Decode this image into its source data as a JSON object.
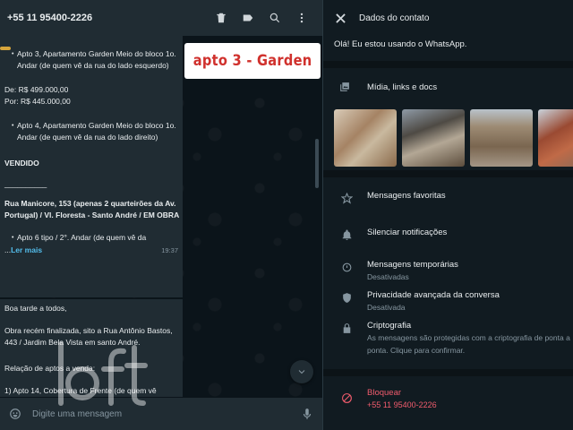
{
  "chat": {
    "header": {
      "phone": "+55 11 95400-2226"
    },
    "bubble1": {
      "apto3": "Apto 3, Apartamento Garden Meio do bloco 1o. Andar (de quem vê da rua do lado esquerdo)",
      "price_de": "De: R$ 499.000,00",
      "price_por": "Por: R$ 445.000,00",
      "apto4": "Apto 4, Apartamento Garden Meio do bloco 1o. Andar (de quem vê da rua do lado direito)",
      "sold": "VENDIDO",
      "divider": "__________",
      "address": "Rua Manicore, 153 (apenas 2 quarteirões da Av. Portugal) / Vl. Floresta - Santo André / EM OBRA",
      "apto6": "Apto 6 tipo / 2°. Andar (de quem vê da",
      "read_more_dots": "...",
      "read_more_link": "Ler mais",
      "time": "19:37"
    },
    "bubble2": {
      "greeting": "Boa tarde a todos,",
      "body": "Obra recém finalizada, sito a Rua Antônio Bastos, 443 / Jardim Bela Vista em santo André.",
      "list_title": "Relação de aptos a venda:",
      "partial": "1)     Apto 14, Cobertura de Frente (de quem vê"
    },
    "overlay_label": "apto 3 - Garden",
    "composer": {
      "placeholder": "Digite uma mensagem"
    }
  },
  "contact_info": {
    "title": "Dados do contato",
    "about": "Olá! Eu estou usando o WhatsApp.",
    "media_label": "Mídia, links e docs",
    "starred": "Mensagens favoritas",
    "mute": "Silenciar notificações",
    "disappearing": {
      "title": "Mensagens temporárias",
      "sub": "Desativadas"
    },
    "privacy": {
      "title": "Privacidade avançada da conversa",
      "sub": "Desativada"
    },
    "encryption": {
      "title": "Criptografia",
      "sub": "As mensagens são protegidas com a criptografia de ponta a ponta. Clique para confirmar."
    },
    "block": {
      "title": "Bloquear",
      "sub": "+55 11 95400-2226"
    }
  },
  "colors": {
    "panel": "#202c33",
    "background": "#0b141a",
    "link": "#53bdeb",
    "danger": "#f15c6d",
    "label_red": "#d0312d"
  },
  "icons": [
    "trash-icon",
    "label-icon",
    "search-icon",
    "more-vertical-icon",
    "close-icon",
    "media-icon",
    "star-icon",
    "bell-icon",
    "timer-icon",
    "shield-icon",
    "lock-icon",
    "block-icon",
    "emoji-icon",
    "mic-icon",
    "chevron-down-icon"
  ]
}
